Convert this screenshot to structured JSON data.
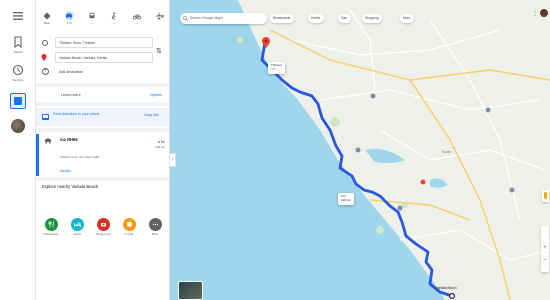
{
  "rail": {
    "menu_icon": "menu-icon",
    "items": [
      {
        "icon": "bookmark-icon",
        "label": "Saved"
      },
      {
        "icon": "history-icon",
        "label": "Recents"
      }
    ]
  },
  "directions": {
    "modes": [
      {
        "icon": "directions-best-icon",
        "label": "Best"
      },
      {
        "icon": "car-icon",
        "label": "4 hr"
      },
      {
        "icon": "train-icon",
        "label": "—"
      },
      {
        "icon": "walk-icon",
        "label": "—"
      },
      {
        "icon": "bike-icon",
        "label": "—"
      },
      {
        "icon": "flight-icon",
        "label": ""
      }
    ],
    "active_mode": 1,
    "origin": "Thrissur Town, Thrissur",
    "destination": "Varkala Beach, Varkala, Kerala",
    "add_destination": "Add destination",
    "leave_now": "Leave now ▾",
    "options": "Options",
    "share_text": "Send directions to your phone",
    "copy_link": "Copy link",
    "route": {
      "via": "via NH66",
      "note": "Fastest route, the usual traffic",
      "details": "Details",
      "time": "4 hr",
      "distance": "196 km"
    },
    "send_header": "Explore nearby Varkala Beach",
    "actions": [
      {
        "icon": "restaurant-icon",
        "label": "Restaurants",
        "color": "#1e8e3e"
      },
      {
        "icon": "hotel-icon",
        "label": "Hotels",
        "color": "#12b5cb"
      },
      {
        "icon": "attractions-icon",
        "label": "Things to do",
        "color": "#d93025"
      },
      {
        "icon": "transit-icon",
        "label": "Transit",
        "color": "#f29900"
      },
      {
        "icon": "more-icon",
        "label": "More",
        "color": "#5f6368"
      }
    ]
  },
  "map": {
    "search_placeholder": "Search Google Maps",
    "chips": [
      {
        "icon": "restaurant-icon",
        "label": "Restaurants"
      },
      {
        "icon": "hotel-icon",
        "label": "Hotels"
      },
      {
        "icon": "gas-icon",
        "label": "Gas"
      },
      {
        "icon": "shopping-icon",
        "label": "Shopping"
      },
      {
        "icon": "more-icon",
        "label": "More"
      }
    ],
    "origin_callout": {
      "line1": "Thrissur",
      "line2": "4 hr"
    },
    "route_callout": {
      "line1": "4 hr",
      "line2": "196 km"
    },
    "dest_label": "Varkala Beach",
    "labels": [
      "Kochi"
    ],
    "colors": {
      "route": "#2a57e0",
      "sea": "#9fd6ec",
      "land": "#eef0ea"
    }
  }
}
